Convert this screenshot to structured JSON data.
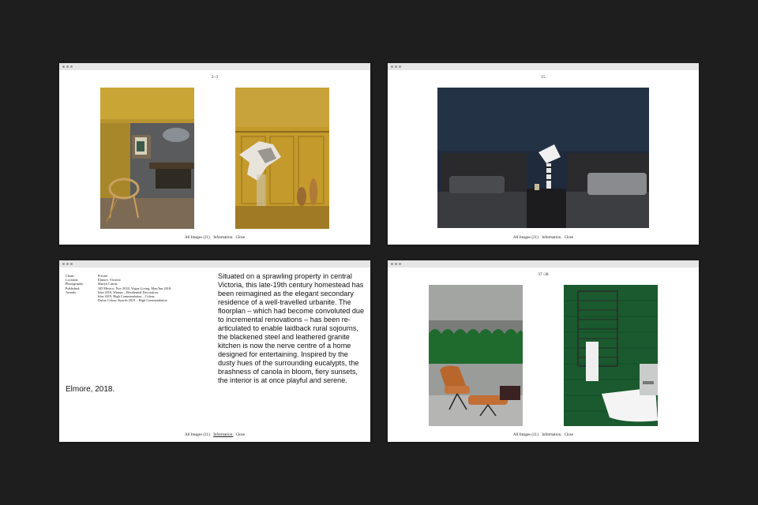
{
  "windows": {
    "w1": {
      "page_label": "2–3"
    },
    "w2": {
      "page_label": "15"
    },
    "w3": {
      "page_label": ""
    },
    "w4": {
      "page_label": "37–38"
    }
  },
  "footer": {
    "all_images": "All Images (21).",
    "information": "Information.",
    "close": "Close"
  },
  "project": {
    "title": "Elmore, 2018.",
    "meta": [
      {
        "key": "Client:",
        "value": "Private"
      },
      {
        "key": "Location:",
        "value": "Elmore, Victoria"
      },
      {
        "key": "Photography:",
        "value": "Sharyn Cairns"
      },
      {
        "key": "Published:",
        "value": "AD Mexico, Nov 2018; Vogue Living, May/Jun 2018;"
      },
      {
        "key": "Awards:",
        "value": "Idea 2019, Winner – Residential Decoration,\nIdea 2019, High Commendation – Colour,\nDulux Colour Awards 2019 – High Commendation"
      }
    ],
    "description": "Situated on a sprawling property in central Victoria, this late-19th century homestead has been reimagined as the elegant secondary residence of a well-travelled urbanite. The floorplan – which had become convoluted due to incremental renovations – has been re-articulated to enable laidback rural sojourns, the blackened steel and leathered granite kitchen is now the nerve centre of a home designed for entertaining. Inspired by the dusty hues of the surrounding eucalypts, the brashness of canola in bloom, fiery sunsets, the interior is at once playful and serene."
  }
}
